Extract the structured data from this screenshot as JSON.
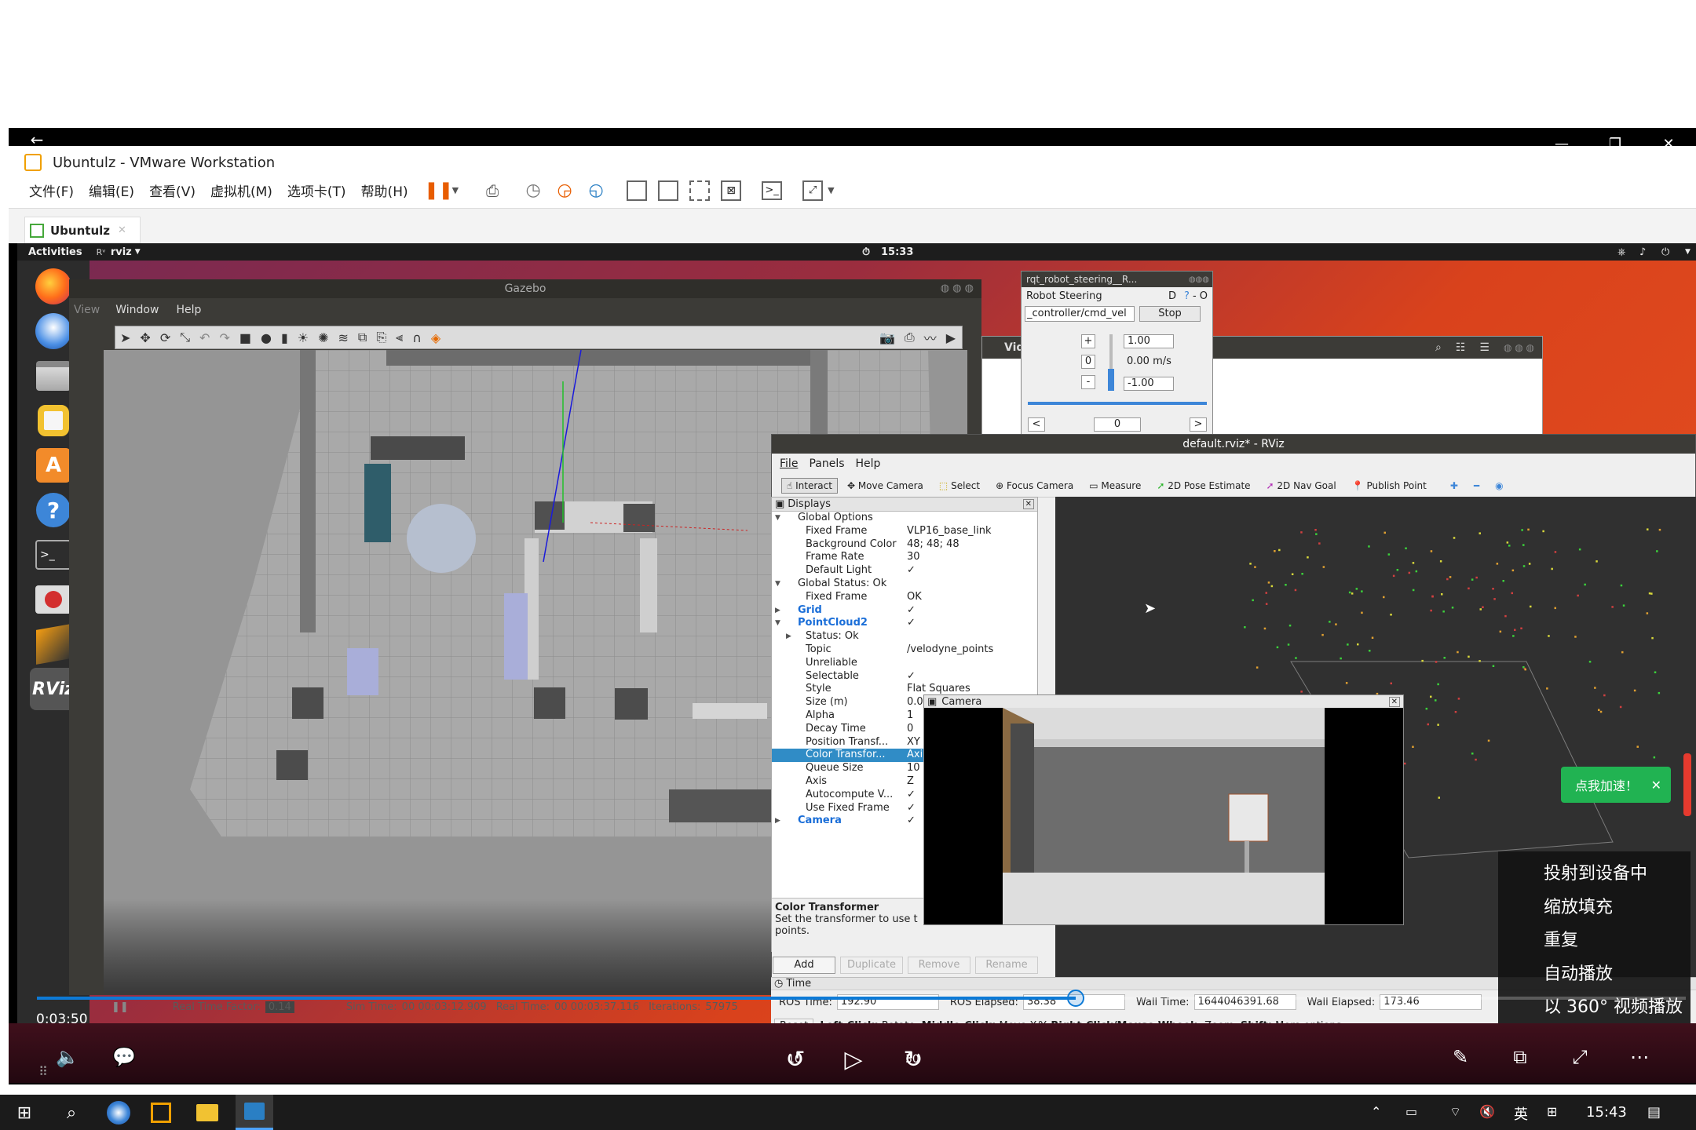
{
  "vmware": {
    "title": "Ubuntulz - VMware Workstation",
    "menu": [
      "文件(F)",
      "编辑(E)",
      "查看(V)",
      "虚拟机(M)",
      "选项卡(T)",
      "帮助(H)"
    ],
    "tab": "Ubuntulz"
  },
  "ubuntu": {
    "activities": "Activities",
    "app_menu": "rviz",
    "clock": "15:33"
  },
  "gazebo": {
    "title": "Gazebo",
    "menu": [
      "View",
      "Window",
      "Help"
    ],
    "status": {
      "rtf_label": "Real Time Factor:",
      "rtf": "0.14",
      "sim_label": "Sim Time:",
      "sim": "00 00:03:12.909",
      "real_label": "Real Time:",
      "real": "00 00:03:37.116",
      "iter_label": "Iterations:",
      "iter": "57975"
    }
  },
  "steering": {
    "title": "rqt_robot_steering__R...",
    "header": "Robot Steering",
    "header_right": "D",
    "topic": "_controller/cmd_vel",
    "stop": "Stop",
    "plus": "+",
    "zero": "0",
    "minus": "-",
    "max": "1.00",
    "speed": "0.00 m/s",
    "min": "-1.00",
    "ang_left": "<",
    "ang_val": "0",
    "ang_right": ">"
  },
  "vidwin": {
    "label": "Vid"
  },
  "rviz": {
    "title": "default.rviz* - RViz",
    "menu": [
      "File",
      "Panels",
      "Help"
    ],
    "tools": [
      "Interact",
      "Move Camera",
      "Select",
      "Focus Camera",
      "Measure",
      "2D Pose Estimate",
      "2D Nav Goal",
      "Publish Point"
    ],
    "displays_title": "Displays",
    "tree": [
      {
        "k": "Global Options",
        "v": "",
        "indent": 0,
        "exp": "▼",
        "color": "#222"
      },
      {
        "k": "Fixed Frame",
        "v": "VLP16_base_link",
        "indent": 1,
        "exp": "",
        "color": "#222"
      },
      {
        "k": "Background Color",
        "v": "48; 48; 48",
        "indent": 1,
        "exp": "",
        "color": "#222"
      },
      {
        "k": "Frame Rate",
        "v": "30",
        "indent": 1,
        "exp": "",
        "color": "#222"
      },
      {
        "k": "Default Light",
        "v": "✓",
        "indent": 1,
        "exp": "",
        "color": "#222"
      },
      {
        "k": "Global Status: Ok",
        "v": "",
        "indent": 0,
        "exp": "▼",
        "color": "#222"
      },
      {
        "k": "Fixed Frame",
        "v": "OK",
        "indent": 1,
        "exp": "",
        "color": "#222"
      },
      {
        "k": "Grid",
        "v": "✓",
        "indent": 0,
        "exp": "▶",
        "color": "#1a6ed8"
      },
      {
        "k": "PointCloud2",
        "v": "✓",
        "indent": 0,
        "exp": "▼",
        "color": "#1a6ed8"
      },
      {
        "k": "Status: Ok",
        "v": "",
        "indent": 1,
        "exp": "▶",
        "color": "#222"
      },
      {
        "k": "Topic",
        "v": "/velodyne_points",
        "indent": 1,
        "exp": "",
        "color": "#222"
      },
      {
        "k": "Unreliable",
        "v": "",
        "indent": 1,
        "exp": "",
        "color": "#222"
      },
      {
        "k": "Selectable",
        "v": "✓",
        "indent": 1,
        "exp": "",
        "color": "#222"
      },
      {
        "k": "Style",
        "v": "Flat Squares",
        "indent": 1,
        "exp": "",
        "color": "#222"
      },
      {
        "k": "Size (m)",
        "v": "0.0",
        "indent": 1,
        "exp": "",
        "color": "#222"
      },
      {
        "k": "Alpha",
        "v": "1",
        "indent": 1,
        "exp": "",
        "color": "#222"
      },
      {
        "k": "Decay Time",
        "v": "0",
        "indent": 1,
        "exp": "",
        "color": "#222"
      },
      {
        "k": "Position Transf...",
        "v": "XY",
        "indent": 1,
        "exp": "",
        "color": "#222"
      },
      {
        "k": "Color Transfor...",
        "v": "Axi",
        "indent": 1,
        "exp": "",
        "color": "#fff",
        "sel": true
      },
      {
        "k": "Queue Size",
        "v": "10",
        "indent": 1,
        "exp": "",
        "color": "#222"
      },
      {
        "k": "Axis",
        "v": "Z",
        "indent": 1,
        "exp": "",
        "color": "#222"
      },
      {
        "k": "Autocompute V...",
        "v": "✓",
        "indent": 1,
        "exp": "",
        "color": "#222"
      },
      {
        "k": "Use Fixed Frame",
        "v": "✓",
        "indent": 1,
        "exp": "",
        "color": "#222"
      },
      {
        "k": "Camera",
        "v": "✓",
        "indent": 0,
        "exp": "▶",
        "color": "#1a6ed8"
      }
    ],
    "help_title": "Color Transformer",
    "help_text": "Set the transformer to use t",
    "help_text2": "points.",
    "buttons": [
      "Add",
      "Duplicate",
      "Remove",
      "Rename"
    ],
    "camera_title": "Camera",
    "time_title": "Time",
    "ros_time_label": "ROS Time:",
    "ros_time": "192.90",
    "ros_elapsed_label": "ROS Elapsed:",
    "ros_elapsed": "38.38",
    "wall_time_label": "Wall Time:",
    "wall_time": "1644046391.68",
    "wall_elapsed_label": "Wall Elapsed:",
    "wall_elapsed": "173.46",
    "reset": "Reset",
    "hint_a": "Left-Click:",
    "hint_b": " Rotate. ",
    "hint_c": "Middle-Click:",
    "hint_d": " Move X/Y. ",
    "hint_e": "Right-Click/Mouse Wheel:",
    "hint_f": ": Zoom. ",
    "hint_g": "Shift:",
    "hint_h": " More options."
  },
  "player": {
    "time": "0:03:50",
    "progress": 0.63,
    "speed_btn": "点我加速！",
    "skip_back": "10",
    "skip_fwd": "30",
    "context_menu": [
      "投射到设备中",
      "缩放填充",
      "重复",
      "自动播放",
      "以 360° 视频播放"
    ]
  },
  "taskbar": {
    "ime": "英",
    "clock": "15:43"
  }
}
